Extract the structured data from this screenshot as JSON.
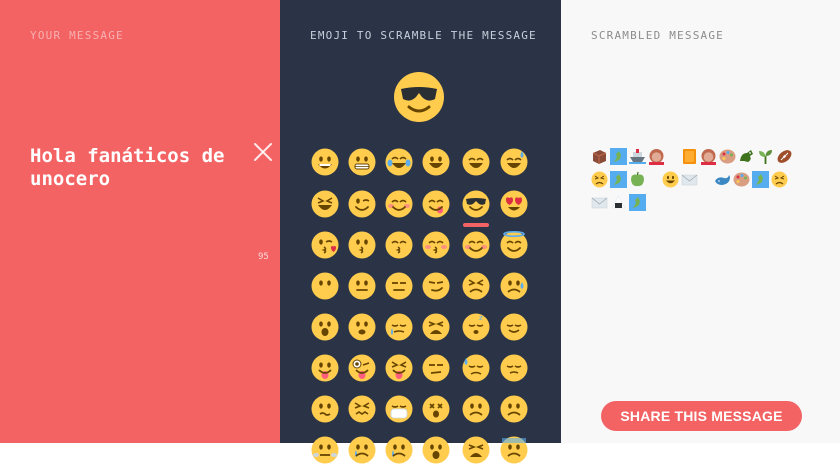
{
  "left_panel": {
    "title": "YOUR MESSAGE",
    "message": "Hola fanáticos de unocero",
    "char_count": "95"
  },
  "middle_panel": {
    "title": "EMOJI TO SCRAMBLE THE MESSAGE",
    "selected_emoji": "smiling-face-with-sunglasses",
    "emoji_grid": [
      [
        "grinning",
        "grimacing",
        "joy",
        "smiley",
        "smile",
        "sweat-smile"
      ],
      [
        "laughing",
        "wink",
        "blush",
        "yum",
        "sunglasses",
        "heart-eyes"
      ],
      [
        "kissing-heart",
        "kissing",
        "kissing-smiling-eyes",
        "kissing-closed-eyes",
        "relaxed",
        "innocent"
      ],
      [
        "no-mouth",
        "neutral",
        "expressionless",
        "smirk",
        "persevere",
        "disappointed-relieved"
      ],
      [
        "open-mouth",
        "hushed",
        "sleepy",
        "tired",
        "sleeping",
        "relieved"
      ],
      [
        "stuck-out-tongue",
        "stuck-out-tongue-winking",
        "stuck-out-tongue-closed-eyes",
        "unamused",
        "sweat",
        "pensive"
      ],
      [
        "confused",
        "confounded",
        "mask",
        "dizzy",
        "disappointed",
        "worried"
      ],
      [
        "triumph",
        "cry",
        "sob",
        "astonished",
        "weary",
        "cold-sweat"
      ]
    ]
  },
  "right_panel": {
    "title": "SCRAMBLED MESSAGE",
    "scrambled_rows": [
      [
        "chocolate",
        "map",
        "ship",
        "woman",
        "gap",
        "orange-book",
        "woman",
        "palette",
        "dragon",
        "seedling",
        "football"
      ],
      [
        "persevere",
        "map",
        "apple",
        "gap",
        "smiley",
        "envelope",
        "gap",
        "whale",
        "palette",
        "map",
        "persevere"
      ],
      [
        "envelope",
        "rice-ball",
        "map"
      ]
    ],
    "share_button": "SHARE THIS MESSAGE"
  },
  "colors": {
    "left_bg": "#f36364",
    "middle_bg": "#2a3446",
    "right_bg": "#f8f8f8",
    "accent": "#f36364",
    "emoji_yellow": "#ffcc4d"
  }
}
